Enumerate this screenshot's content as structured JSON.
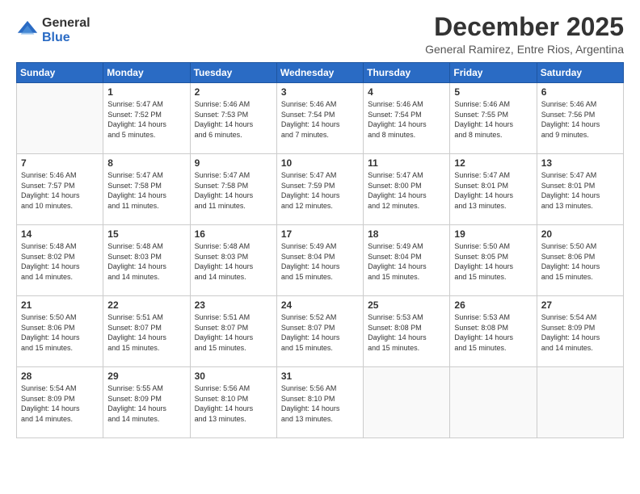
{
  "logo": {
    "general": "General",
    "blue": "Blue"
  },
  "title": "December 2025",
  "subtitle": "General Ramirez, Entre Rios, Argentina",
  "days_of_week": [
    "Sunday",
    "Monday",
    "Tuesday",
    "Wednesday",
    "Thursday",
    "Friday",
    "Saturday"
  ],
  "weeks": [
    [
      {
        "num": "",
        "detail": ""
      },
      {
        "num": "1",
        "detail": "Sunrise: 5:47 AM\nSunset: 7:52 PM\nDaylight: 14 hours\nand 5 minutes."
      },
      {
        "num": "2",
        "detail": "Sunrise: 5:46 AM\nSunset: 7:53 PM\nDaylight: 14 hours\nand 6 minutes."
      },
      {
        "num": "3",
        "detail": "Sunrise: 5:46 AM\nSunset: 7:54 PM\nDaylight: 14 hours\nand 7 minutes."
      },
      {
        "num": "4",
        "detail": "Sunrise: 5:46 AM\nSunset: 7:54 PM\nDaylight: 14 hours\nand 8 minutes."
      },
      {
        "num": "5",
        "detail": "Sunrise: 5:46 AM\nSunset: 7:55 PM\nDaylight: 14 hours\nand 8 minutes."
      },
      {
        "num": "6",
        "detail": "Sunrise: 5:46 AM\nSunset: 7:56 PM\nDaylight: 14 hours\nand 9 minutes."
      }
    ],
    [
      {
        "num": "7",
        "detail": "Sunrise: 5:46 AM\nSunset: 7:57 PM\nDaylight: 14 hours\nand 10 minutes."
      },
      {
        "num": "8",
        "detail": "Sunrise: 5:47 AM\nSunset: 7:58 PM\nDaylight: 14 hours\nand 11 minutes."
      },
      {
        "num": "9",
        "detail": "Sunrise: 5:47 AM\nSunset: 7:58 PM\nDaylight: 14 hours\nand 11 minutes."
      },
      {
        "num": "10",
        "detail": "Sunrise: 5:47 AM\nSunset: 7:59 PM\nDaylight: 14 hours\nand 12 minutes."
      },
      {
        "num": "11",
        "detail": "Sunrise: 5:47 AM\nSunset: 8:00 PM\nDaylight: 14 hours\nand 12 minutes."
      },
      {
        "num": "12",
        "detail": "Sunrise: 5:47 AM\nSunset: 8:01 PM\nDaylight: 14 hours\nand 13 minutes."
      },
      {
        "num": "13",
        "detail": "Sunrise: 5:47 AM\nSunset: 8:01 PM\nDaylight: 14 hours\nand 13 minutes."
      }
    ],
    [
      {
        "num": "14",
        "detail": "Sunrise: 5:48 AM\nSunset: 8:02 PM\nDaylight: 14 hours\nand 14 minutes."
      },
      {
        "num": "15",
        "detail": "Sunrise: 5:48 AM\nSunset: 8:03 PM\nDaylight: 14 hours\nand 14 minutes."
      },
      {
        "num": "16",
        "detail": "Sunrise: 5:48 AM\nSunset: 8:03 PM\nDaylight: 14 hours\nand 14 minutes."
      },
      {
        "num": "17",
        "detail": "Sunrise: 5:49 AM\nSunset: 8:04 PM\nDaylight: 14 hours\nand 15 minutes."
      },
      {
        "num": "18",
        "detail": "Sunrise: 5:49 AM\nSunset: 8:04 PM\nDaylight: 14 hours\nand 15 minutes."
      },
      {
        "num": "19",
        "detail": "Sunrise: 5:50 AM\nSunset: 8:05 PM\nDaylight: 14 hours\nand 15 minutes."
      },
      {
        "num": "20",
        "detail": "Sunrise: 5:50 AM\nSunset: 8:06 PM\nDaylight: 14 hours\nand 15 minutes."
      }
    ],
    [
      {
        "num": "21",
        "detail": "Sunrise: 5:50 AM\nSunset: 8:06 PM\nDaylight: 14 hours\nand 15 minutes."
      },
      {
        "num": "22",
        "detail": "Sunrise: 5:51 AM\nSunset: 8:07 PM\nDaylight: 14 hours\nand 15 minutes."
      },
      {
        "num": "23",
        "detail": "Sunrise: 5:51 AM\nSunset: 8:07 PM\nDaylight: 14 hours\nand 15 minutes."
      },
      {
        "num": "24",
        "detail": "Sunrise: 5:52 AM\nSunset: 8:07 PM\nDaylight: 14 hours\nand 15 minutes."
      },
      {
        "num": "25",
        "detail": "Sunrise: 5:53 AM\nSunset: 8:08 PM\nDaylight: 14 hours\nand 15 minutes."
      },
      {
        "num": "26",
        "detail": "Sunrise: 5:53 AM\nSunset: 8:08 PM\nDaylight: 14 hours\nand 15 minutes."
      },
      {
        "num": "27",
        "detail": "Sunrise: 5:54 AM\nSunset: 8:09 PM\nDaylight: 14 hours\nand 14 minutes."
      }
    ],
    [
      {
        "num": "28",
        "detail": "Sunrise: 5:54 AM\nSunset: 8:09 PM\nDaylight: 14 hours\nand 14 minutes."
      },
      {
        "num": "29",
        "detail": "Sunrise: 5:55 AM\nSunset: 8:09 PM\nDaylight: 14 hours\nand 14 minutes."
      },
      {
        "num": "30",
        "detail": "Sunrise: 5:56 AM\nSunset: 8:10 PM\nDaylight: 14 hours\nand 13 minutes."
      },
      {
        "num": "31",
        "detail": "Sunrise: 5:56 AM\nSunset: 8:10 PM\nDaylight: 14 hours\nand 13 minutes."
      },
      {
        "num": "",
        "detail": ""
      },
      {
        "num": "",
        "detail": ""
      },
      {
        "num": "",
        "detail": ""
      }
    ]
  ]
}
